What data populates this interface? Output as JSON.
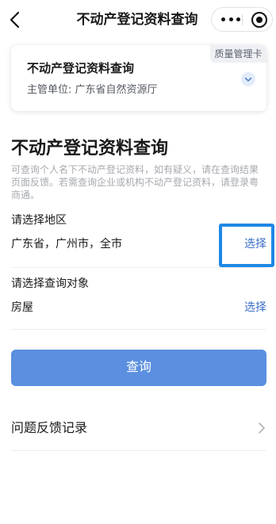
{
  "nav": {
    "title": "不动产登记资料查询",
    "back_icon": "chevron-left-icon",
    "more_icon": "more-dots-icon",
    "close_icon": "close-circle-icon"
  },
  "card": {
    "title": "不动产登记资料查询",
    "dept_label": "主管单位:",
    "dept_value": "广东省自然资源厅",
    "tag": "质量管理卡",
    "expand_icon": "chevron-down-icon"
  },
  "main": {
    "title": "不动产登记资料查询",
    "description": "可查询个人名下不动产登记资料，如有疑义，请在查询结果页面反馈。若需查询企业或机构不动产登记资料，请登录粤商通。"
  },
  "region": {
    "label": "请选择地区",
    "value": "广东省，广州市，全市",
    "select_label": "选择"
  },
  "target": {
    "label": "请选择查询对象",
    "value": "房屋",
    "select_label": "选择"
  },
  "query_button": {
    "label": "查询"
  },
  "feedback": {
    "label": "问题反馈记录",
    "icon": "chevron-right-icon"
  },
  "colors": {
    "accent": "#3b6fc6",
    "button": "#5b8fe0",
    "highlight": "#1e88e5"
  }
}
